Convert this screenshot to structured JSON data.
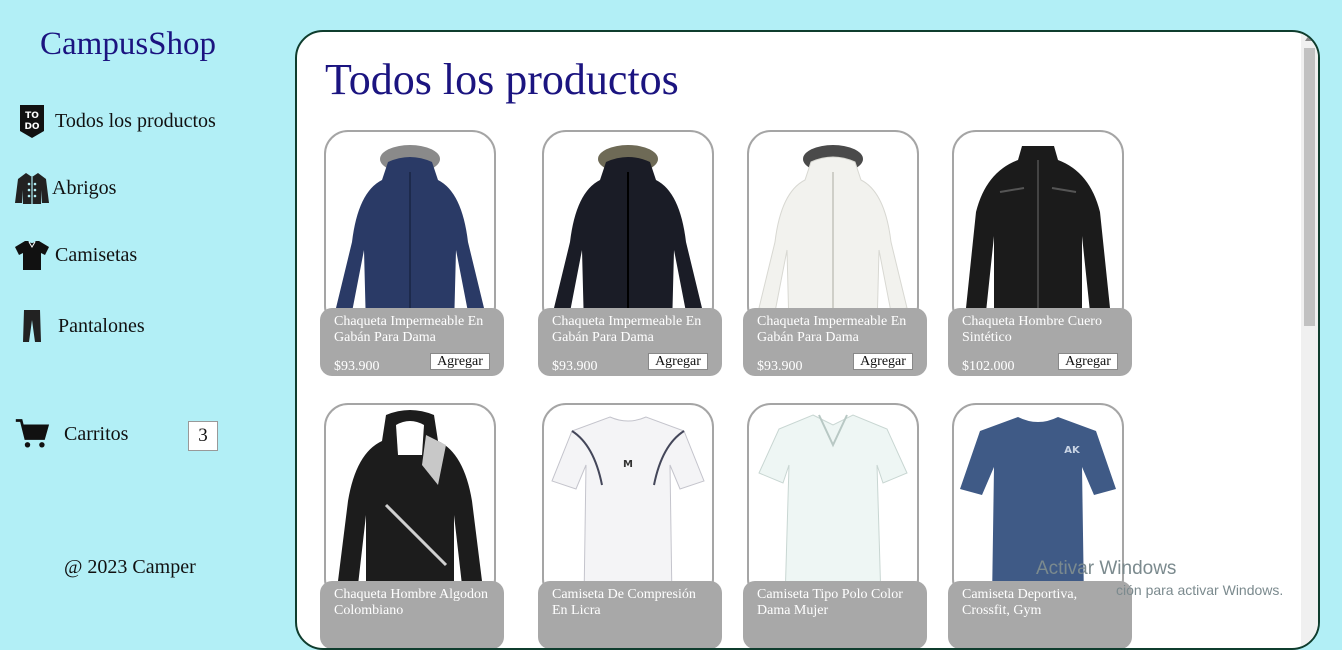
{
  "brand": "CampusShop",
  "nav": [
    {
      "label": "Todos los productos",
      "icon": "todo-icon"
    },
    {
      "label": "Abrigos",
      "icon": "coat-icon"
    },
    {
      "label": "Camisetas",
      "icon": "tshirt-icon"
    },
    {
      "label": "Pantalones",
      "icon": "pants-icon"
    }
  ],
  "cart": {
    "label": "Carritos",
    "count": "3",
    "icon": "cart-icon"
  },
  "footer": "@ 2023 Camper",
  "main": {
    "title": "Todos los productos",
    "products": [
      {
        "name": "Chaqueta Impermeable En Gabán Para Dama",
        "price": "$93.900",
        "button": "Agregar",
        "color": "#2a3a66"
      },
      {
        "name": "Chaqueta Impermeable En Gabán Para Dama",
        "price": "$93.900",
        "button": "Agregar",
        "color": "#1a1c26"
      },
      {
        "name": "Chaqueta Impermeable En Gabán Para Dama",
        "price": "$93.900",
        "button": "Agregar",
        "color": "#f2f2ee"
      },
      {
        "name": "Chaqueta Hombre Cuero Sintético",
        "price": "$102.000",
        "button": "Agregar",
        "color": "#1b1b1b"
      },
      {
        "name": "Chaqueta Hombre Algodon Colombiano",
        "price": "",
        "button": "",
        "color": "#1c1c1c"
      },
      {
        "name": "Camiseta De Compresión En Licra",
        "price": "",
        "button": "",
        "color": "#f4f4f6"
      },
      {
        "name": "Camiseta Tipo Polo Color Dama Mujer",
        "price": "",
        "button": "",
        "color": "#eef6f4"
      },
      {
        "name": "Camiseta Deportiva, Crossfit, Gym",
        "price": "",
        "button": "",
        "color": "#3f5a86"
      }
    ]
  },
  "watermark": {
    "line1": "Activar Windows",
    "line2": "ción para activar Windows."
  },
  "colors": {
    "background": "#b2eff6",
    "brand": "#1b1480",
    "card_info": "#a8a8a8",
    "main_border": "#0f3d2e"
  }
}
